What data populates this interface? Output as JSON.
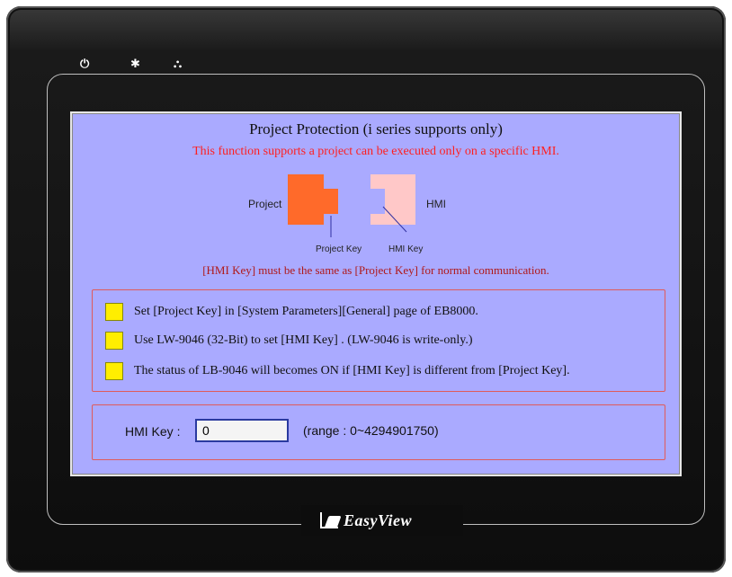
{
  "device": {
    "brand": "EasyView",
    "indicators": {
      "power_glyph": "⏻",
      "cpu_glyph": "✱",
      "network_glyph": "⛬"
    }
  },
  "screen": {
    "title": "Project Protection (i series supports only)",
    "subtitle": "This function supports a project can be executed only on a specific HMI.",
    "diagram": {
      "project_label": "Project",
      "hmi_label": "HMI",
      "project_key_label": "Project Key",
      "hmi_key_label": "HMI Key",
      "project_color": "#ff6a2a",
      "hmi_color": "#ffc8c8"
    },
    "note": "[HMI Key] must be the same as [Project Key] for normal communication.",
    "steps": [
      "Set [Project Key] in [System Parameters][General] page of EB8000.",
      "Use LW-9046 (32-Bit) to set [HMI Key] . (LW-9046 is write-only.)",
      "The status of LB-9046 will becomes ON if [HMI Key] is different from [Project Key]."
    ],
    "hmi_key": {
      "label": "HMI Key :",
      "value": "0",
      "range": "(range : 0~4294901750)"
    }
  },
  "colors": {
    "screen_bg": "#aaaaff",
    "accent_red": "#ff1f1f",
    "indicator_yellow": "#ffee00"
  }
}
